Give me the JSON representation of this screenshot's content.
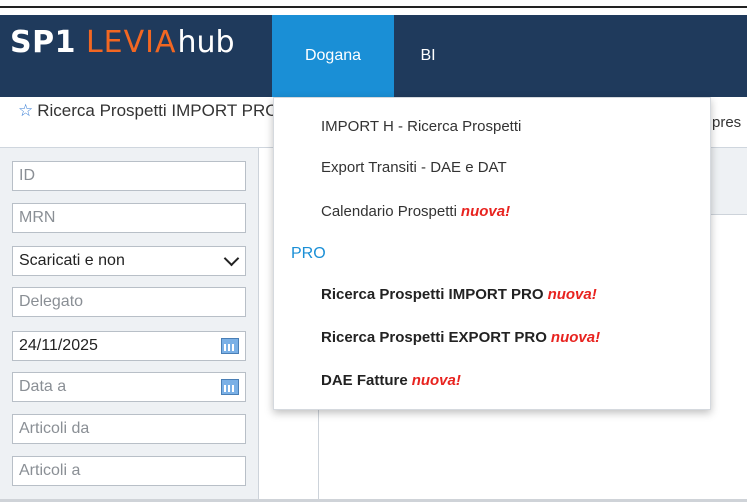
{
  "brand": {
    "sp1": "SP1",
    "levia": "LEVIA",
    "hub": "hub",
    "accent": "#f26722"
  },
  "nav": {
    "dogana": "Dogana",
    "bi": "BI",
    "bg": "#1f3a5c",
    "active_bg": "#1a8fd6"
  },
  "page": {
    "title": "Ricerca Prospetti IMPORT PRO",
    "star_icon": "star-icon",
    "right_fragment": "pres"
  },
  "filters": {
    "id_placeholder": "ID",
    "mrn_placeholder": "MRN",
    "status_value": "Scaricati e non",
    "delegato_placeholder": "Delegato",
    "date_from_value": "24/11/2025",
    "date_to_placeholder": "Data a",
    "articoli_da_placeholder": "Articoli da",
    "articoli_a_placeholder": "Articoli a"
  },
  "menu": {
    "items": [
      {
        "label": "IMPORT H - Ricerca Prospetti",
        "new": ""
      },
      {
        "label": "Export Transiti - DAE e DAT",
        "new": ""
      },
      {
        "label": "Calendario Prospetti",
        "new": "nuova!"
      }
    ],
    "section": "PRO",
    "pro_items": [
      {
        "label": "Ricerca Prospetti IMPORT PRO",
        "new": "nuova!"
      },
      {
        "label": "Ricerca Prospetti EXPORT PRO",
        "new": "nuova!"
      },
      {
        "label": "DAE Fatture",
        "new": "nuova!"
      }
    ],
    "new_color": "#e8231f",
    "section_color": "#1a8fd6"
  }
}
